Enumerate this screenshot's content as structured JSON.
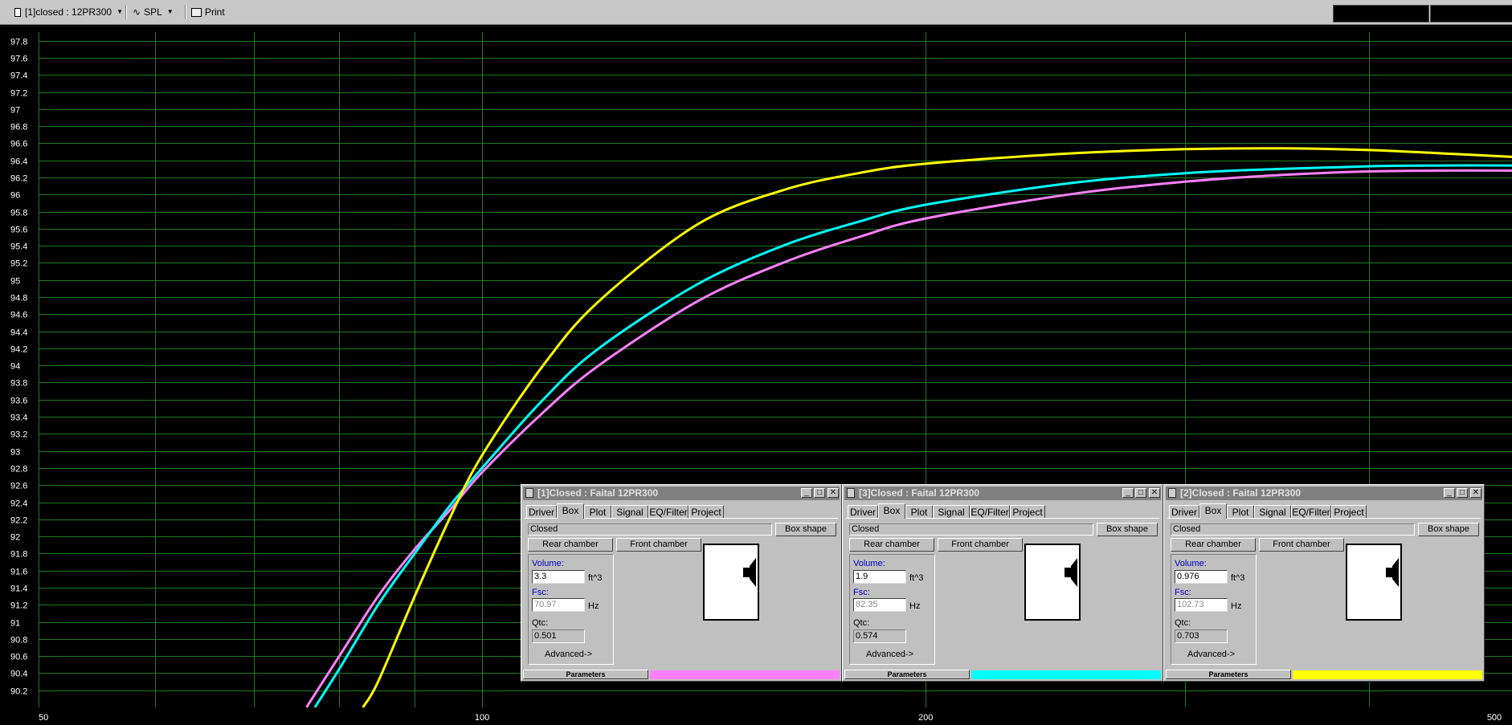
{
  "toolbar": {
    "project_selector": "[1]closed : 12PR300",
    "graph_selector": "SPL",
    "print_label": "Print"
  },
  "chart_data": {
    "type": "line",
    "x_scale": "log",
    "xlim": [
      50,
      500
    ],
    "ylim": [
      90.0,
      97.9
    ],
    "x_ticks": [
      50,
      100,
      200,
      500
    ],
    "y_ticks": [
      90.2,
      90.4,
      90.6,
      90.8,
      91,
      91.2,
      91.4,
      91.6,
      91.8,
      92,
      92.2,
      92.4,
      92.6,
      92.8,
      93,
      93.2,
      93.4,
      93.6,
      93.8,
      94,
      94.2,
      94.4,
      94.6,
      94.8,
      95,
      95.2,
      95.4,
      95.6,
      95.8,
      96,
      96.2,
      96.4,
      96.6,
      96.8,
      97,
      97.2,
      97.4,
      97.6,
      97.8
    ],
    "grid": true,
    "series": [
      {
        "color": "#ff80ff",
        "x": [
          76,
          80,
          85,
          90,
          95,
          100,
          110,
          120,
          140,
          160,
          180,
          200,
          250,
          300,
          350,
          400,
          450,
          500
        ],
        "y": [
          90.0,
          90.6,
          91.3,
          91.85,
          92.3,
          92.75,
          93.45,
          94.0,
          94.75,
          95.2,
          95.5,
          95.72,
          96.0,
          96.15,
          96.23,
          96.27,
          96.28,
          96.28
        ]
      },
      {
        "color": "#00ffff",
        "x": [
          77,
          80,
          85,
          90,
          95,
          100,
          110,
          120,
          140,
          160,
          180,
          200,
          250,
          300,
          350,
          400,
          450,
          500
        ],
        "y": [
          90.0,
          90.45,
          91.2,
          91.8,
          92.35,
          92.8,
          93.6,
          94.2,
          94.95,
          95.4,
          95.68,
          95.88,
          96.13,
          96.25,
          96.3,
          96.33,
          96.34,
          96.34
        ]
      },
      {
        "color": "#ffff00",
        "x": [
          83,
          85,
          90,
          95,
          100,
          110,
          120,
          140,
          160,
          180,
          200,
          250,
          300,
          350,
          400,
          450,
          500
        ],
        "y": [
          90.0,
          90.3,
          91.3,
          92.2,
          92.95,
          94.0,
          94.75,
          95.65,
          96.05,
          96.25,
          96.36,
          96.48,
          96.53,
          96.54,
          96.52,
          96.48,
          96.44
        ]
      }
    ]
  },
  "panels": [
    {
      "title": "[1]Closed : Faital 12PR300",
      "tabs": [
        "Driver",
        "Box",
        "Plot",
        "Signal",
        "EQ/Filter",
        "Project"
      ],
      "box_type": "Closed",
      "box_shape_label": "Box shape",
      "rear_chamber_label": "Rear chamber",
      "front_chamber_label": "Front chamber",
      "volume_label": "Volume:",
      "volume_value": "3.3",
      "volume_unit": "ft^3",
      "fsc_label": "Fsc:",
      "fsc_value": "70.97",
      "fsc_unit": "Hz",
      "qtc_label": "Qtc:",
      "qtc_value": "0.501",
      "advanced_label": "Advanced->",
      "parameters_label": "Parameters",
      "color": "#ff80ff"
    },
    {
      "title": "[3]Closed : Faital 12PR300",
      "tabs": [
        "Driver",
        "Box",
        "Plot",
        "Signal",
        "EQ/Filter",
        "Project"
      ],
      "box_type": "Closed",
      "box_shape_label": "Box shape",
      "rear_chamber_label": "Rear chamber",
      "front_chamber_label": "Front chamber",
      "volume_label": "Volume:",
      "volume_value": "1.9",
      "volume_unit": "ft^3",
      "fsc_label": "Fsc:",
      "fsc_value": "82.35",
      "fsc_unit": "Hz",
      "qtc_label": "Qtc:",
      "qtc_value": "0.574",
      "advanced_label": "Advanced->",
      "parameters_label": "Parameters",
      "color": "#00ffff"
    },
    {
      "title": "[2]Closed : Faital 12PR300",
      "tabs": [
        "Driver",
        "Box",
        "Plot",
        "Signal",
        "EQ/Filter",
        "Project"
      ],
      "box_type": "Closed",
      "box_shape_label": "Box shape",
      "rear_chamber_label": "Rear chamber",
      "front_chamber_label": "Front chamber",
      "volume_label": "Volume:",
      "volume_value": "0.976",
      "volume_unit": "ft^3",
      "fsc_label": "Fsc:",
      "fsc_value": "102.73",
      "fsc_unit": "Hz",
      "qtc_label": "Qtc:",
      "qtc_value": "0.703",
      "advanced_label": "Advanced->",
      "parameters_label": "Parameters",
      "color": "#ffff00"
    }
  ]
}
